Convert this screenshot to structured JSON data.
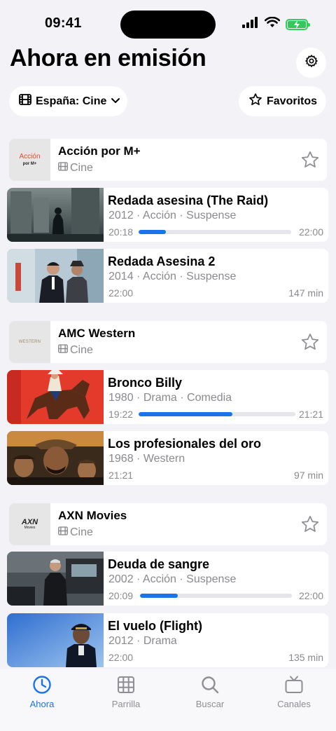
{
  "status_bar": {
    "time": "09:41"
  },
  "header": {
    "title": "Ahora en emisión"
  },
  "filters": {
    "region": "España: Cine",
    "favorites": "Favoritos"
  },
  "colors": {
    "accent": "#1a73e8",
    "battery": "#34c759"
  },
  "channels": [
    {
      "name": "Acción por M+",
      "type": "Cine",
      "logo_text": "Acción",
      "logo_sub": "por M+",
      "programs": [
        {
          "title": "Redada asesina (The Raid)",
          "meta": "2012 · Acción · Suspense",
          "start": "20:18",
          "end": "22:00",
          "progress": 0.18
        },
        {
          "title": "Redada Asesina 2",
          "meta": "2014 · Acción · Suspense",
          "start": "22:00",
          "end": "147 min"
        }
      ]
    },
    {
      "name": "AMC Western",
      "type": "Cine",
      "logo_text": "WESTERN",
      "logo_sub": "",
      "programs": [
        {
          "title": "Bronco Billy",
          "meta": "1980 · Drama · Comedia",
          "start": "19:22",
          "end": "21:21",
          "progress": 0.6
        },
        {
          "title": "Los profesionales del oro",
          "meta": "1968 · Western",
          "start": "21:21",
          "end": "97 min"
        }
      ]
    },
    {
      "name": "AXN Movies",
      "type": "Cine",
      "logo_text": "AXN",
      "logo_sub": "Movies",
      "programs": [
        {
          "title": "Deuda de sangre",
          "meta": "2002 · Acción · Suspense",
          "start": "20:09",
          "end": "22:00",
          "progress": 0.25
        },
        {
          "title": "El vuelo (Flight)",
          "meta": "2012 · Drama",
          "start": "22:00",
          "end": "135 min"
        }
      ]
    }
  ],
  "tabs": [
    {
      "label": "Ahora",
      "icon": "clock-icon",
      "active": true
    },
    {
      "label": "Parrilla",
      "icon": "grid-icon"
    },
    {
      "label": "Buscar",
      "icon": "search-icon"
    },
    {
      "label": "Canales",
      "icon": "tv-icon"
    }
  ]
}
